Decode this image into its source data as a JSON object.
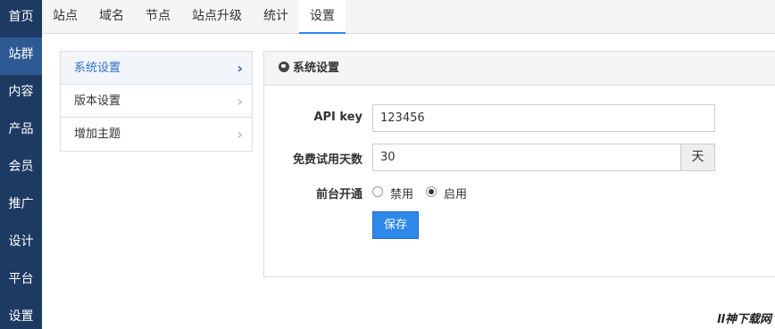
{
  "sidebar": {
    "items": [
      {
        "label": "首页"
      },
      {
        "label": "站群",
        "active": true
      },
      {
        "label": "内容"
      },
      {
        "label": "产品"
      },
      {
        "label": "会员"
      },
      {
        "label": "推广"
      },
      {
        "label": "设计"
      },
      {
        "label": "平台"
      },
      {
        "label": "设置"
      }
    ]
  },
  "topnav": {
    "tabs": [
      "站点",
      "域名",
      "节点",
      "站点升级",
      "统计",
      "设置"
    ],
    "active": "设置"
  },
  "menu": {
    "items": [
      "系统设置",
      "版本设置",
      "增加主题"
    ],
    "active": "系统设置"
  },
  "panel": {
    "title": "系统设置",
    "icon": "globe-icon",
    "api_key_label": "API key",
    "api_key_value": "123456",
    "trial_label": "免费试用天数",
    "trial_value": "30",
    "trial_unit": "天",
    "frontend_label": "前台开通",
    "option_disable": "禁用",
    "option_enable": "启用",
    "frontend_selected": "启用",
    "save_label": "保存"
  },
  "watermark": "ll神下载网",
  "colors": {
    "sidebar_bg": "#1d3a63",
    "sidebar_active": "#2e5a93",
    "accent": "#2d88e8"
  }
}
